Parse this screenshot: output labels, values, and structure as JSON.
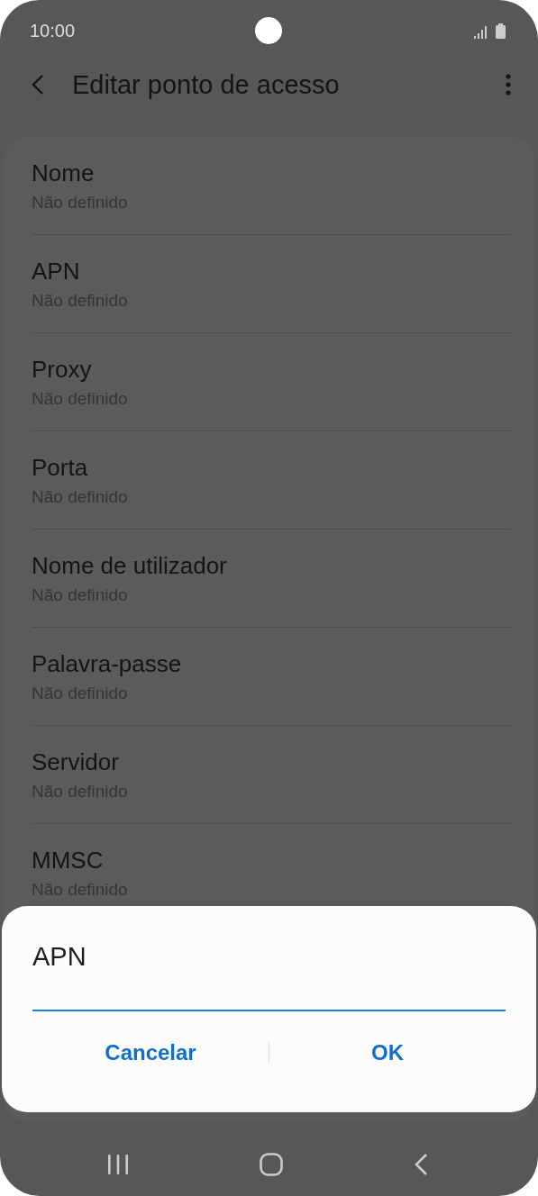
{
  "status_bar": {
    "time": "10:00"
  },
  "header": {
    "title": "Editar ponto de acesso"
  },
  "settings": [
    {
      "label": "Nome",
      "value": "Não definido"
    },
    {
      "label": "APN",
      "value": "Não definido"
    },
    {
      "label": "Proxy",
      "value": "Não definido"
    },
    {
      "label": "Porta",
      "value": "Não definido"
    },
    {
      "label": "Nome de utilizador",
      "value": "Não definido"
    },
    {
      "label": "Palavra-passe",
      "value": "Não definido"
    },
    {
      "label": "Servidor",
      "value": "Não definido"
    },
    {
      "label": "MMSC",
      "value": "Não definido"
    }
  ],
  "dialog": {
    "title": "APN",
    "buttons": [
      "Cancelar",
      "OK"
    ]
  }
}
